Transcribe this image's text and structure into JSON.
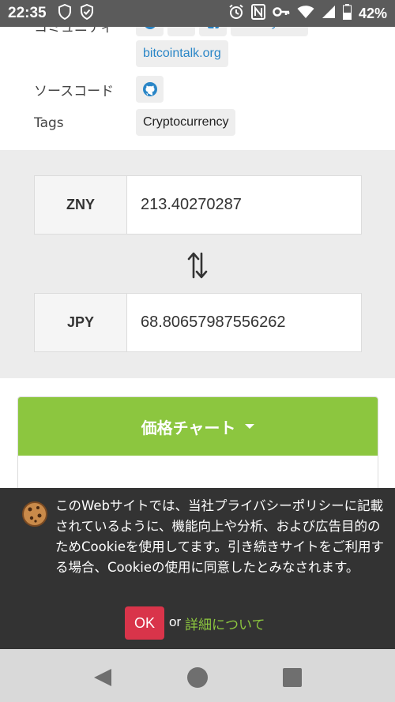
{
  "status_bar": {
    "time": "22:35",
    "battery": "42%",
    "icons": [
      "shield-outline-icon",
      "shield-check-icon",
      "alarm-icon",
      "nfc-icon",
      "key-icon",
      "wifi-icon",
      "signal-icon",
      "battery-icon"
    ]
  },
  "info": {
    "community_label": "コミュニティ",
    "community_links": [
      "bitzeny.info",
      "bitcointalk.org"
    ],
    "source_label": "ソースコード",
    "source_icon": "github-icon",
    "tags_label": "Tags",
    "tags": [
      "Cryptocurrency"
    ]
  },
  "converter": {
    "from_currency": "ZNY",
    "from_value": "213.40270287",
    "to_currency": "JPY",
    "to_value": "68.80657987556262",
    "swap_icon": "swap-vertical-icon"
  },
  "price_chart": {
    "header_label": "価格チャート",
    "caret_icon": "caret-down-icon"
  },
  "cookie_banner": {
    "message": "このWebサイトでは、当社プライバシーポリシーに記載されているように、機能向上や分析、および広告目的のためCookieを使用してます。引き続きサイトをご利用する場合、Cookieの使用に同意したとみなされます。",
    "ok_label": "OK",
    "or_label": "or",
    "details_label": "詳細について"
  },
  "colors": {
    "accent_green": "#8cc63f",
    "ok_red": "#d9344a",
    "link_blue": "#2a86c7",
    "banner_bg": "#333333"
  }
}
